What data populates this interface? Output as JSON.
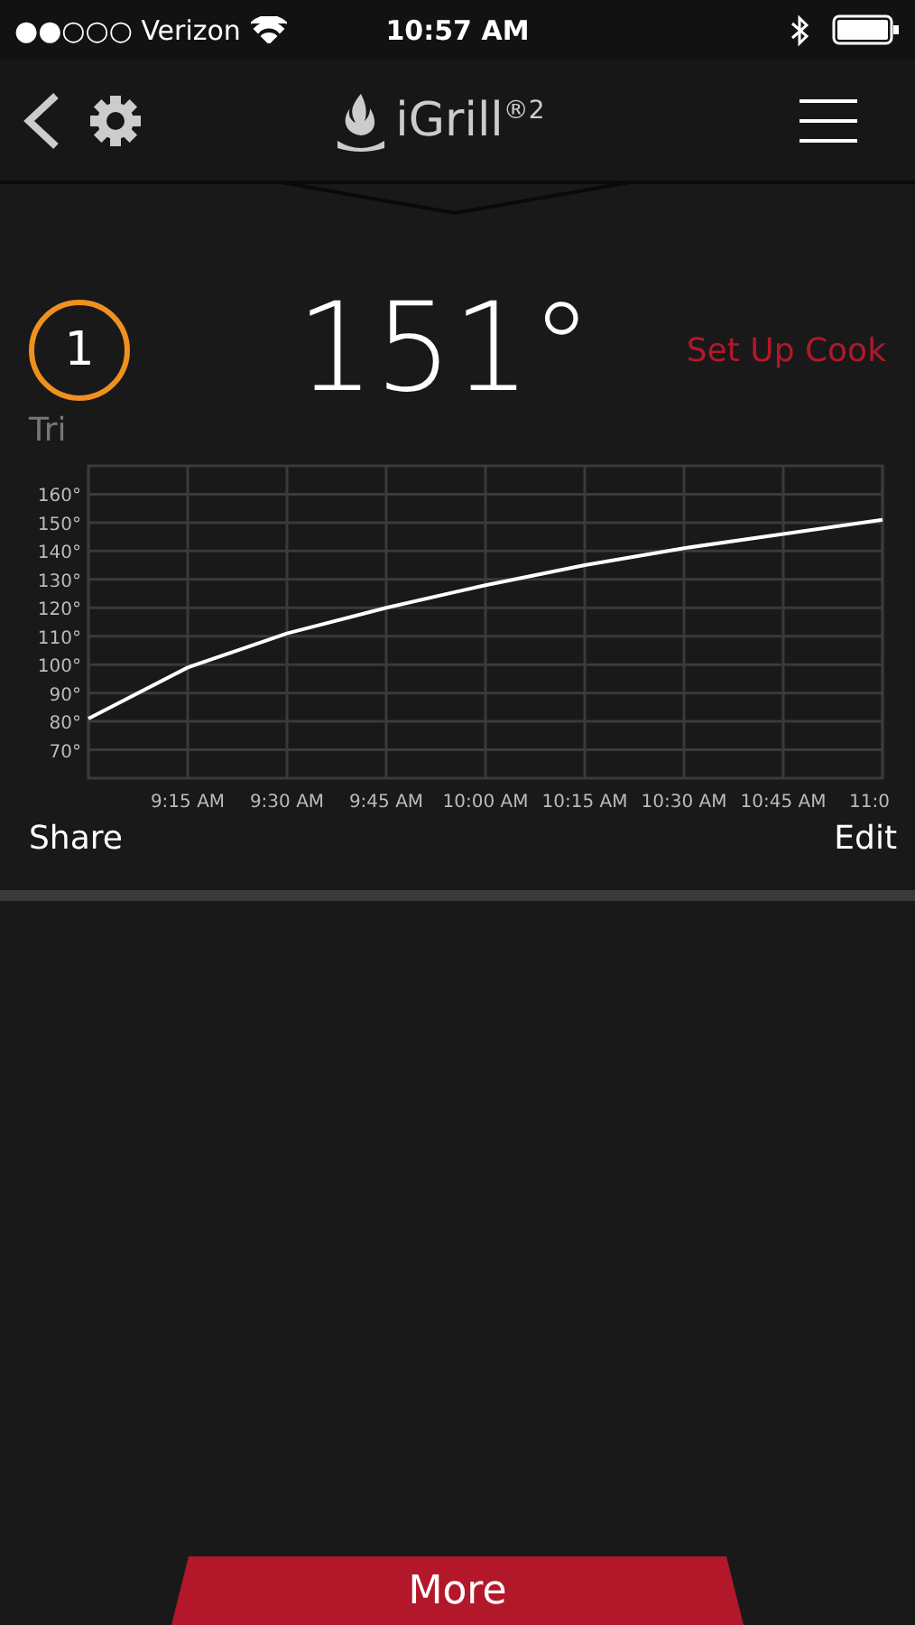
{
  "status_bar": {
    "carrier": "●●○○○ Verizon",
    "time": "10:57 AM"
  },
  "header": {
    "logo": "iGrill",
    "logo_mark": "®2"
  },
  "probe": {
    "number": "1",
    "color": "#f0901e",
    "temperature": "151°",
    "name": "Tri",
    "setup_link": "Set Up Cook"
  },
  "chart_data": {
    "type": "line",
    "categories": [
      null,
      "9:15 AM",
      "9:30 AM",
      "9:45 AM",
      "10:00 AM",
      "10:15 AM",
      "10:30 AM",
      "10:45 AM",
      "11:0"
    ],
    "ylim": [
      60,
      170
    ],
    "grid": true,
    "yticks": [
      {
        "value": 70,
        "label": "70°"
      },
      {
        "value": 80,
        "label": "80°"
      },
      {
        "value": 90,
        "label": "90°"
      },
      {
        "value": 100,
        "label": "100°"
      },
      {
        "value": 110,
        "label": "110°"
      },
      {
        "value": 120,
        "label": "120°"
      },
      {
        "value": 130,
        "label": "130°"
      },
      {
        "value": 140,
        "label": "140°"
      },
      {
        "value": 150,
        "label": "150°"
      },
      {
        "value": 160,
        "label": "160°"
      }
    ],
    "series": [
      {
        "color": "#ffffff",
        "values": [
          81,
          99,
          111,
          120,
          128,
          135,
          141,
          146,
          151
        ]
      }
    ]
  },
  "actions": {
    "share": "Share",
    "edit": "Edit"
  },
  "more_button": "More"
}
